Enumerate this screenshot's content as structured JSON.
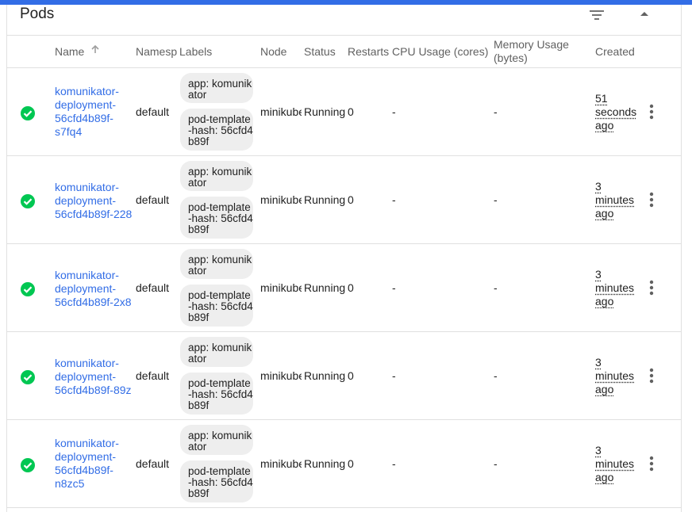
{
  "card": {
    "title": "Pods"
  },
  "icons": {
    "filter": "filter-list-icon",
    "collapse": "arrow-drop-up-icon",
    "sort": "arrow-up-icon",
    "status": "check-circle-icon",
    "menu": "more-vert-icon"
  },
  "colors": {
    "accent": "#326de6",
    "success": "#00c752",
    "chip": "#eeeeee"
  },
  "columns": {
    "name": "Name",
    "namespace": "Namespace",
    "labels": "Labels",
    "node": "Node",
    "status": "Status",
    "restarts": "Restarts",
    "cpu": "CPU Usage (cores)",
    "memory": "Memory Usage (bytes)",
    "created": "Created"
  },
  "rows": [
    {
      "name": "komunikator-deployment-56cfd4b89f-s7fq4",
      "name_lines": [
        "komunikator-",
        "deployment-",
        "56cfd4b89f-",
        "s7fq4"
      ],
      "namespace": "default",
      "label_app": "app: komunikator",
      "label_hash": "pod-template-hash: 56cfd4b89f",
      "node": "minikube",
      "status": "Running",
      "restarts": "0",
      "cpu": "-",
      "memory": "-",
      "created_lines": [
        "51",
        "seconds",
        "ago"
      ]
    },
    {
      "name": "komunikator-deployment-56cfd4b89f-228",
      "name_lines": [
        "komunikator-",
        "deployment-",
        "56cfd4b89f-228"
      ],
      "namespace": "default",
      "label_app": "app: komunikator",
      "label_hash": "pod-template-hash: 56cfd4b89f",
      "node": "minikube",
      "status": "Running",
      "restarts": "0",
      "cpu": "-",
      "memory": "-",
      "created_lines": [
        "3",
        "minutes",
        "ago"
      ]
    },
    {
      "name": "komunikator-deployment-56cfd4b89f-2x8",
      "name_lines": [
        "komunikator-",
        "deployment-",
        "56cfd4b89f-2x8"
      ],
      "namespace": "default",
      "label_app": "app: komunikator",
      "label_hash": "pod-template-hash: 56cfd4b89f",
      "node": "minikube",
      "status": "Running",
      "restarts": "0",
      "cpu": "-",
      "memory": "-",
      "created_lines": [
        "3",
        "minutes",
        "ago"
      ]
    },
    {
      "name": "komunikator-deployment-56cfd4b89f-89z",
      "name_lines": [
        "komunikator-",
        "deployment-",
        "56cfd4b89f-89z"
      ],
      "namespace": "default",
      "label_app": "app: komunikator",
      "label_hash": "pod-template-hash: 56cfd4b89f",
      "node": "minikube",
      "status": "Running",
      "restarts": "0",
      "cpu": "-",
      "memory": "-",
      "created_lines": [
        "3",
        "minutes",
        "ago"
      ]
    },
    {
      "name": "komunikator-deployment-56cfd4b89f-n8zc5",
      "name_lines": [
        "komunikator-",
        "deployment-",
        "56cfd4b89f-",
        "n8zc5"
      ],
      "namespace": "default",
      "label_app": "app: komunikator",
      "label_hash": "pod-template-hash: 56cfd4b89f",
      "node": "minikube",
      "status": "Running",
      "restarts": "0",
      "cpu": "-",
      "memory": "-",
      "created_lines": [
        "3",
        "minutes",
        "ago"
      ]
    }
  ]
}
